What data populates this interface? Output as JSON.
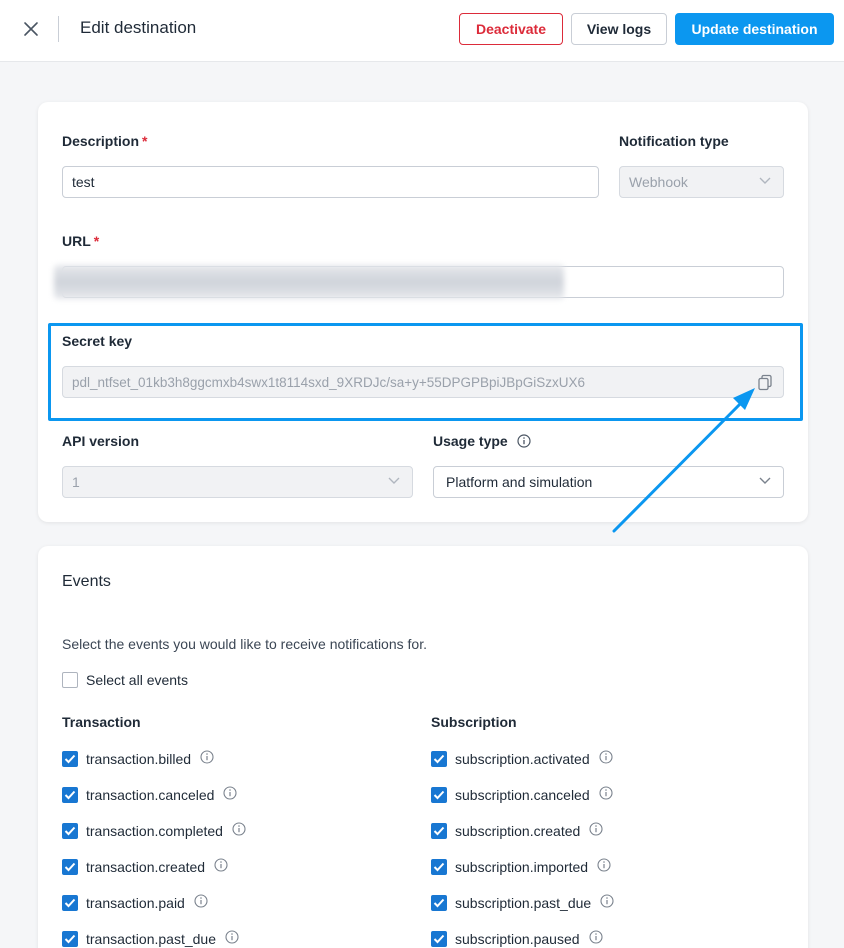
{
  "header": {
    "title": "Edit destination",
    "deactivate_label": "Deactivate",
    "view_logs_label": "View logs",
    "update_label": "Update destination"
  },
  "form": {
    "description_label": "Description",
    "description_required": "*",
    "description_value": "test",
    "notification_type_label": "Notification type",
    "notification_type_value": "Webhook",
    "url_label": "URL",
    "url_required": "*",
    "secret_key_label": "Secret key",
    "secret_key_value": "pdl_ntfset_01kb3h8ggcmxb4swx1t8114sxd_9XRDJc/sa+y+55DPGPBpiJBpGiSzxUX6",
    "api_version_label": "API version",
    "api_version_value": "1",
    "usage_type_label": "Usage type",
    "usage_type_value": "Platform and simulation"
  },
  "events": {
    "title": "Events",
    "helper": "Select the events you would like to receive notifications for.",
    "select_all_label": "Select all events",
    "transaction_heading": "Transaction",
    "subscription_heading": "Subscription",
    "transaction_items": [
      "transaction.billed",
      "transaction.canceled",
      "transaction.completed",
      "transaction.created",
      "transaction.paid",
      "transaction.past_due"
    ],
    "subscription_items": [
      "subscription.activated",
      "subscription.canceled",
      "subscription.created",
      "subscription.imported",
      "subscription.past_due",
      "subscription.paused"
    ]
  },
  "colors": {
    "accent": "#0b97f0",
    "danger": "#dc2b3a",
    "checkbox": "#1877d2"
  }
}
